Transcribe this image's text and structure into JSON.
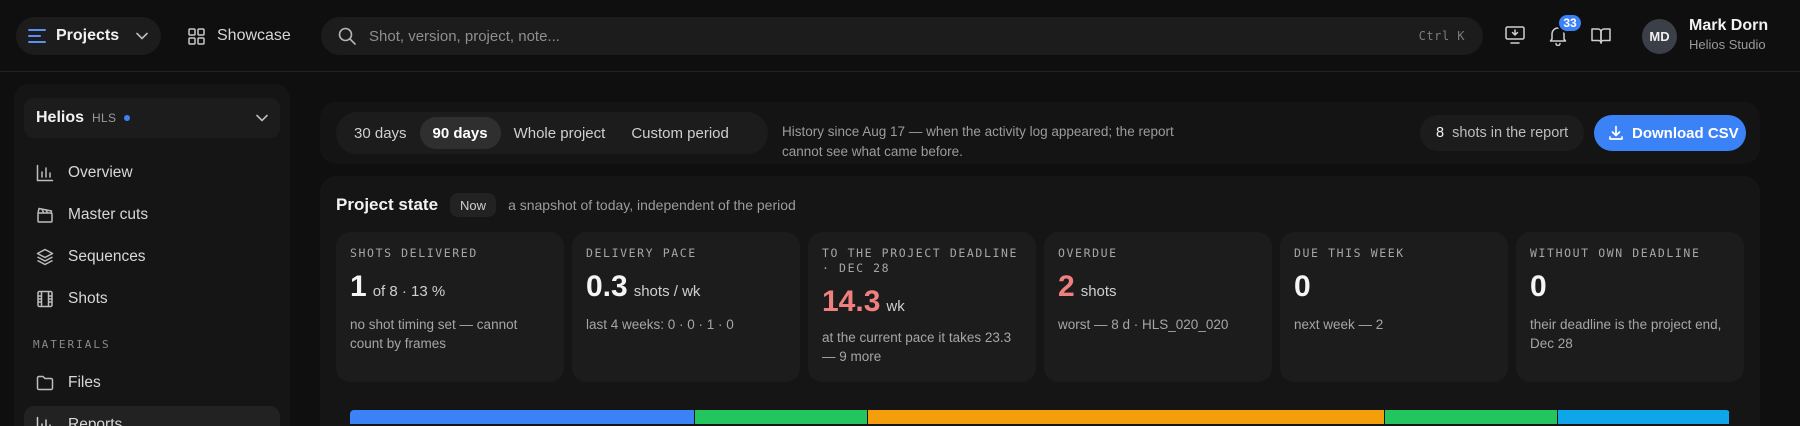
{
  "topbar": {
    "projects_label": "Projects",
    "showcase_label": "Showcase",
    "search": {
      "placeholder": "Shot, version, project, note...",
      "shortcut": "Ctrl K"
    },
    "notifications_count": "33",
    "user": {
      "initials": "MD",
      "name": "Mark Dorn",
      "studio": "Helios Studio"
    }
  },
  "sidebar": {
    "project": {
      "name": "Helios",
      "code": "HLS"
    },
    "items": [
      {
        "label": "Overview",
        "icon": "bar-chart-icon"
      },
      {
        "label": "Master cuts",
        "icon": "clapperboard-icon"
      },
      {
        "label": "Sequences",
        "icon": "layers-icon"
      },
      {
        "label": "Shots",
        "icon": "film-icon"
      }
    ],
    "materials_heading": "MATERIALS",
    "materials": [
      {
        "label": "Files",
        "icon": "folder-icon"
      },
      {
        "label": "Reports",
        "icon": "bar-chart-icon",
        "active": true
      }
    ]
  },
  "period": {
    "options": [
      "30 days",
      "90 days",
      "Whole project",
      "Custom period"
    ],
    "selected": "90 days",
    "note": "History since Aug 17 — when the activity log appeared; the report cannot see what came before.",
    "shots_count": "8",
    "shots_label": "shots in the report",
    "download_label": "Download CSV"
  },
  "state": {
    "title": "Project state",
    "badge": "Now",
    "subtitle": "a snapshot of today, independent of the period",
    "metrics": [
      {
        "label": "Shots delivered",
        "value": "1",
        "unit": "of 8 · 13 %",
        "note": "no shot timing set — cannot count by frames",
        "accent": "#f5f5f5"
      },
      {
        "label": "Delivery pace",
        "value": "0.3",
        "unit": "shots / wk",
        "note": "last 4 weeks: 0 · 0 · 1 · 0",
        "accent": "#f5f5f5"
      },
      {
        "label": "To the project deadline · Dec 28",
        "value": "14.3",
        "unit": "wk",
        "note": "at the current pace it takes 23.3 — 9 more",
        "accent": "#f08080"
      },
      {
        "label": "Overdue",
        "value": "2",
        "unit": "shots",
        "note": "worst — 8 d · HLS_020_020",
        "accent": "#f08080"
      },
      {
        "label": "Due this week",
        "value": "0",
        "unit": "",
        "note": "next week — 2",
        "accent": "#f5f5f5"
      },
      {
        "label": "Without own deadline",
        "value": "0",
        "unit": "",
        "note": "their deadline is the project end, Dec 28",
        "accent": "#f5f5f5"
      }
    ],
    "status_stripe": [
      {
        "color": "#3b82f6",
        "share": 2
      },
      {
        "color": "#22c55e",
        "share": 1
      },
      {
        "color": "#f59e0b",
        "share": 3
      },
      {
        "color": "#22c55e",
        "share": 1
      },
      {
        "color": "#0ea5e9",
        "share": 1
      }
    ]
  }
}
